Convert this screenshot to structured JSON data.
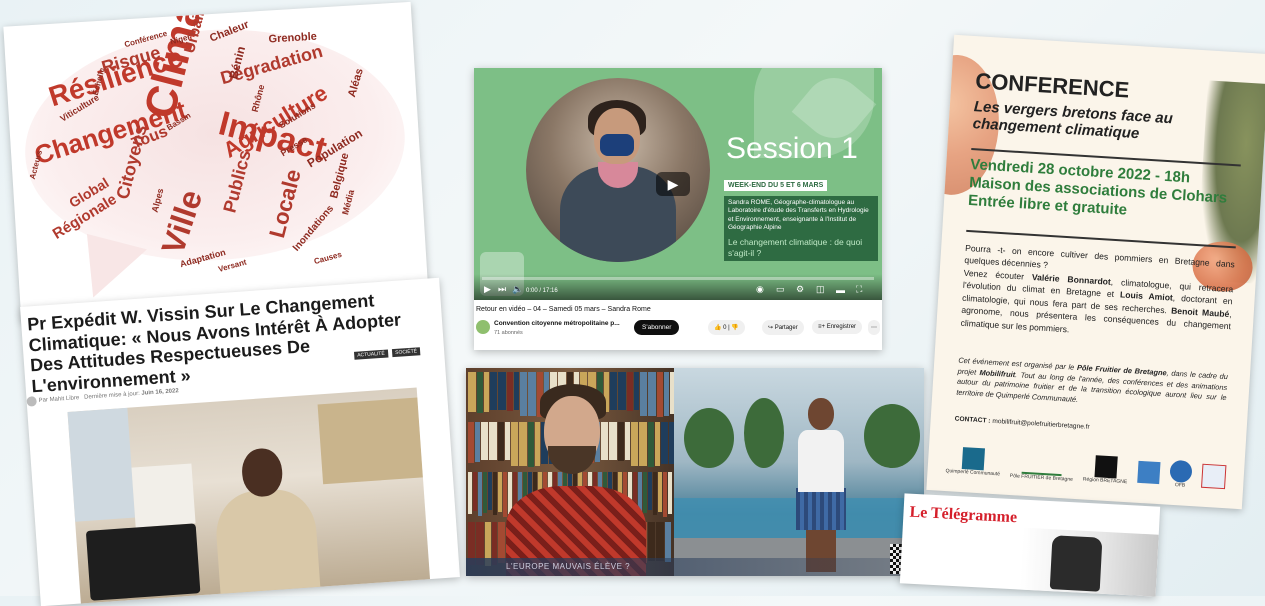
{
  "wordcloud": {
    "words": [
      {
        "text": "Climatique",
        "color": "#c0392b"
      },
      {
        "text": "Résilience",
        "color": "#c0392b"
      },
      {
        "text": "Impact",
        "color": "#c0392b"
      },
      {
        "text": "Changement",
        "color": "#c0392b"
      },
      {
        "text": "Agriculture",
        "color": "#c0392b"
      },
      {
        "text": "Ville",
        "color": "#b03a2e"
      },
      {
        "text": "Dégradation",
        "color": "#b03a2e"
      },
      {
        "text": "Risque",
        "color": "#b03a2e"
      },
      {
        "text": "Urbain",
        "color": "#b03a2e"
      },
      {
        "text": "Citoyens",
        "color": "#b03a2e"
      },
      {
        "text": "Locale",
        "color": "#b03a2e"
      },
      {
        "text": "Publics",
        "color": "#b03a2e"
      },
      {
        "text": "Régionale",
        "color": "#b03a2e"
      },
      {
        "text": "Global",
        "color": "#b03a2e"
      },
      {
        "text": "Tous",
        "color": "#b03a2e"
      },
      {
        "text": "Bénin",
        "color": "#8e2a20"
      },
      {
        "text": "Population",
        "color": "#8e2a20"
      },
      {
        "text": "Belgique",
        "color": "#8e2a20"
      },
      {
        "text": "Inondations",
        "color": "#8e2a20"
      },
      {
        "text": "Chaleur",
        "color": "#8e2a20"
      },
      {
        "text": "Grenoble",
        "color": "#8e2a20"
      },
      {
        "text": "Aléas",
        "color": "#8e2a20"
      },
      {
        "text": "Adaptation",
        "color": "#8e2a20"
      },
      {
        "text": "Média",
        "color": "#8e2a20"
      },
      {
        "text": "Rhône",
        "color": "#8e2a20"
      },
      {
        "text": "Alpes",
        "color": "#8e2a20"
      },
      {
        "text": "Solutions",
        "color": "#8e2a20"
      },
      {
        "text": "Viticulture",
        "color": "#8e2a20"
      },
      {
        "text": "Presse",
        "color": "#8e2a20"
      },
      {
        "text": "Conférence",
        "color": "#8e2a20"
      },
      {
        "text": "Niger",
        "color": "#8e2a20"
      },
      {
        "text": "Causes",
        "color": "#8e2a20"
      },
      {
        "text": "Acteurs",
        "color": "#8e2a20"
      },
      {
        "text": "Échelle",
        "color": "#8e2a20"
      },
      {
        "text": "Bassin",
        "color": "#8e2a20"
      },
      {
        "text": "Versant",
        "color": "#8e2a20"
      }
    ]
  },
  "video1": {
    "session_label": "Session 1",
    "weekend": "WEEK-END DU 5 ET 6 MARS",
    "speaker_desc": "Sandra ROME, Géographe-climatologue au Laboratoire d'étude des Transferts en Hydrologie et Environnement, enseignante à l'Institut de Géographie Alpine",
    "topic": "Le changement climatique : de quoi s'agit-il ?",
    "time": "0:00 / 17:16",
    "progress": 0.0,
    "title": "Retour en vidéo – 04 – Samedi 05 mars – Sandra Rome",
    "channel": "Convention citoyenne métropolitaine p...",
    "subscribers": "71 abonnés",
    "subscribe_label": "S'abonner",
    "like_count": "0",
    "share_label": "Partager",
    "save_label": "Enregistrer",
    "more_label": "⋯"
  },
  "article": {
    "headline": "Pr Expédit W. Vissin Sur Le Changement Climatique: « Nous Avons Intérêt À Adopter Des Attitudes Respectueuses De L'environnement »",
    "tags": [
      "ACTUALITÉ",
      "SOCIÉTÉ"
    ],
    "author": "Par Mahit Libre",
    "date_label": "Dernière mise à jour:",
    "date": "Juin 16, 2022"
  },
  "video2": {
    "ticker": "L'EUROPE MAUVAIS ÉLÈVE ?"
  },
  "poster": {
    "heading": "CONFERENCE",
    "subtitle": "Les vergers bretons face au changement climatique",
    "date_line1": "Vendredi 28 octobre 2022 - 18h",
    "date_line2": "Maison des associations de Clohars",
    "date_line3": "Entrée libre et gratuite",
    "body_p1": "Pourra -t- on encore cultiver des pommiers en Bretagne dans quelques décennies ?",
    "body_p2a": "Venez écouter ",
    "speaker1": "Valérie Bonnardot",
    "body_p2b": ", climatologue, qui retracera l'évolution du climat en Bretagne et ",
    "speaker2": "Louis Amiot",
    "body_p2c": ", doctorant en climatologie, qui nous fera part de ses recherches. ",
    "speaker3": "Benoit Maubé",
    "body_p2d": ", agronome, nous présentera les conséquences du changement climatique sur les pommiers.",
    "note_a": "Cet événement est organisé par le ",
    "note_org": "Pôle Fruitier de Bretagne",
    "note_b": ", dans le cadre du projet ",
    "note_proj": "Mobilifruit",
    "note_c": ". Tout au long de l'année, des conférences et des animations autour du patrimoine fruitier et de la transition écologique auront lieu sur le territoire de Quimperlé Communauté.",
    "contact_label": "CONTACT :",
    "contact": "mobilifruit@polefruitierbretagne.fr",
    "logos": [
      "Quimperlé Communauté",
      "Pôle FRUITIER de Bretagne",
      "Région BRETAGNE",
      "",
      "OFB",
      ""
    ]
  },
  "telegramme": {
    "masthead": "Le Télégramme"
  }
}
